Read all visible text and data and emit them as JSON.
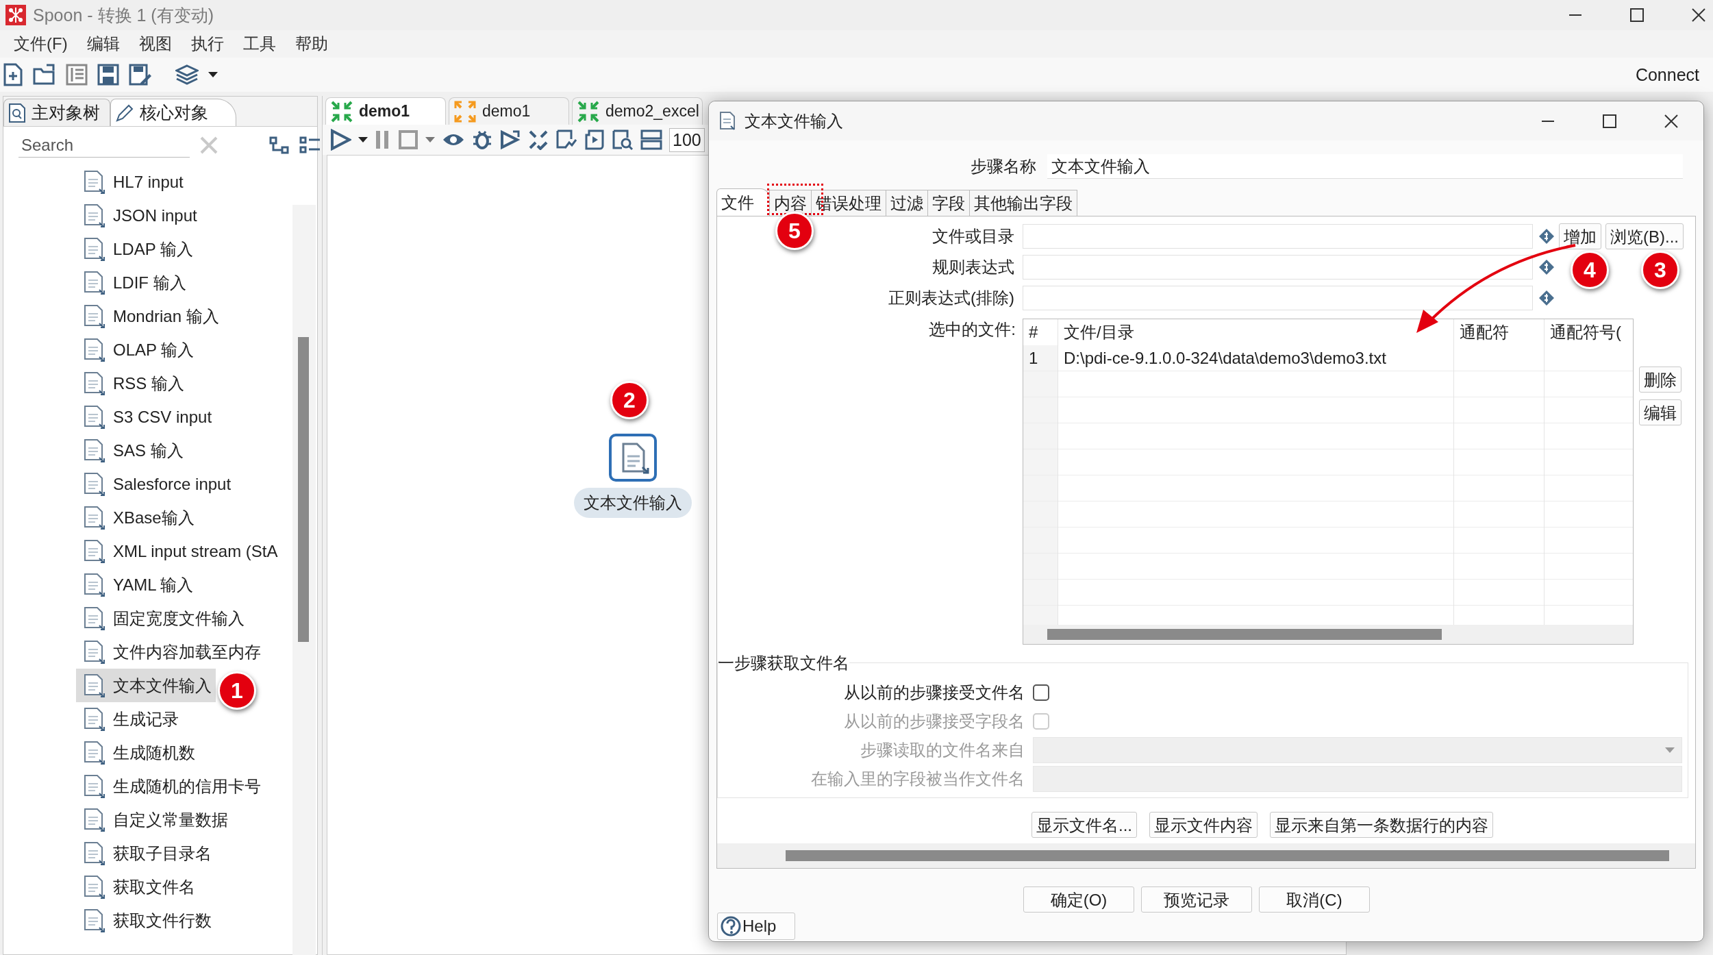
{
  "window": {
    "title": "Spoon - 转换 1 (有变动)"
  },
  "menu": [
    "文件(F)",
    "编辑",
    "视图",
    "执行",
    "工具",
    "帮助"
  ],
  "toolbar": {
    "connect": "Connect"
  },
  "left_panel": {
    "tabs": [
      {
        "label": "主对象树",
        "selected": false
      },
      {
        "label": "核心对象",
        "selected": true
      }
    ],
    "search": {
      "placeholder": "Search"
    },
    "items": [
      {
        "label": "HL7 input",
        "selected": false
      },
      {
        "label": "JSON input",
        "selected": false
      },
      {
        "label": "LDAP 输入",
        "selected": false
      },
      {
        "label": "LDIF 输入",
        "selected": false
      },
      {
        "label": "Mondrian 输入",
        "selected": false
      },
      {
        "label": "OLAP 输入",
        "selected": false
      },
      {
        "label": "RSS 输入",
        "selected": false
      },
      {
        "label": "S3 CSV input",
        "selected": false
      },
      {
        "label": "SAS 输入",
        "selected": false
      },
      {
        "label": "Salesforce input",
        "selected": false
      },
      {
        "label": "XBase输入",
        "selected": false
      },
      {
        "label": "XML input stream (StA",
        "selected": false
      },
      {
        "label": "YAML 输入",
        "selected": false
      },
      {
        "label": "固定宽度文件输入",
        "selected": false
      },
      {
        "label": "文件内容加载至内存",
        "selected": false
      },
      {
        "label": "文本文件输入",
        "selected": true
      },
      {
        "label": "生成记录",
        "selected": false
      },
      {
        "label": "生成随机数",
        "selected": false
      },
      {
        "label": "生成随机的信用卡号",
        "selected": false
      },
      {
        "label": "自定义常量数据",
        "selected": false
      },
      {
        "label": "获取子目录名",
        "selected": false
      },
      {
        "label": "获取文件名",
        "selected": false
      },
      {
        "label": "获取文件行数",
        "selected": false
      }
    ]
  },
  "canvas": {
    "tabs": [
      {
        "label": "demo1",
        "selected": true,
        "kind": "transformation"
      },
      {
        "label": "demo1",
        "selected": false,
        "kind": "job"
      },
      {
        "label": "demo2_excel",
        "selected": false,
        "kind": "transformation"
      }
    ],
    "zoom": "100",
    "node": {
      "label": "文本文件输入"
    }
  },
  "dialog": {
    "title": "文本文件输入",
    "step_name": {
      "label": "步骤名称",
      "value": "文本文件输入"
    },
    "tabs": [
      {
        "label": "文件",
        "selected": true
      },
      {
        "label": "内容",
        "selected": false
      },
      {
        "label": "错误处理",
        "selected": false
      },
      {
        "label": "过滤",
        "selected": false
      },
      {
        "label": "字段",
        "selected": false
      },
      {
        "label": "其他输出字段",
        "selected": false
      }
    ],
    "file_rows": [
      {
        "label": "文件或目录",
        "buttons": [
          "增加",
          "浏览(B)..."
        ]
      },
      {
        "label": "规则表达式"
      },
      {
        "label": "正则表达式(排除)"
      }
    ],
    "selected_files": {
      "label": "选中的文件:",
      "columns": [
        "#",
        "文件/目录",
        "通配符",
        "通配符号("
      ],
      "rows": [
        {
          "number": "1",
          "path": "D:\\pdi-ce-9.1.0.0-324\\data\\demo3\\demo3.txt"
        }
      ],
      "buttons": [
        "删除",
        "编辑"
      ]
    },
    "previous_step": {
      "title": "一步骤获取文件名",
      "rows": [
        {
          "kind": "checkbox",
          "label": "从以前的步骤接受文件名",
          "checked": false,
          "disabled": false
        },
        {
          "kind": "checkbox",
          "label": "从以前的步骤接受字段名",
          "checked": false,
          "disabled": true
        },
        {
          "kind": "dropdown",
          "label": "步骤读取的文件名来自",
          "disabled": true
        },
        {
          "kind": "text",
          "label": "在输入里的字段被当作文件名",
          "disabled": true
        }
      ]
    },
    "show_buttons": [
      "显示文件名...",
      "显示文件内容",
      "显示来自第一条数据行的内容"
    ],
    "footer_buttons": [
      "确定(O)",
      "预览记录",
      "取消(C)"
    ],
    "help": "Help"
  },
  "annotations": [
    {
      "number": "1"
    },
    {
      "number": "2"
    },
    {
      "number": "3"
    },
    {
      "number": "4"
    },
    {
      "number": "5"
    }
  ]
}
